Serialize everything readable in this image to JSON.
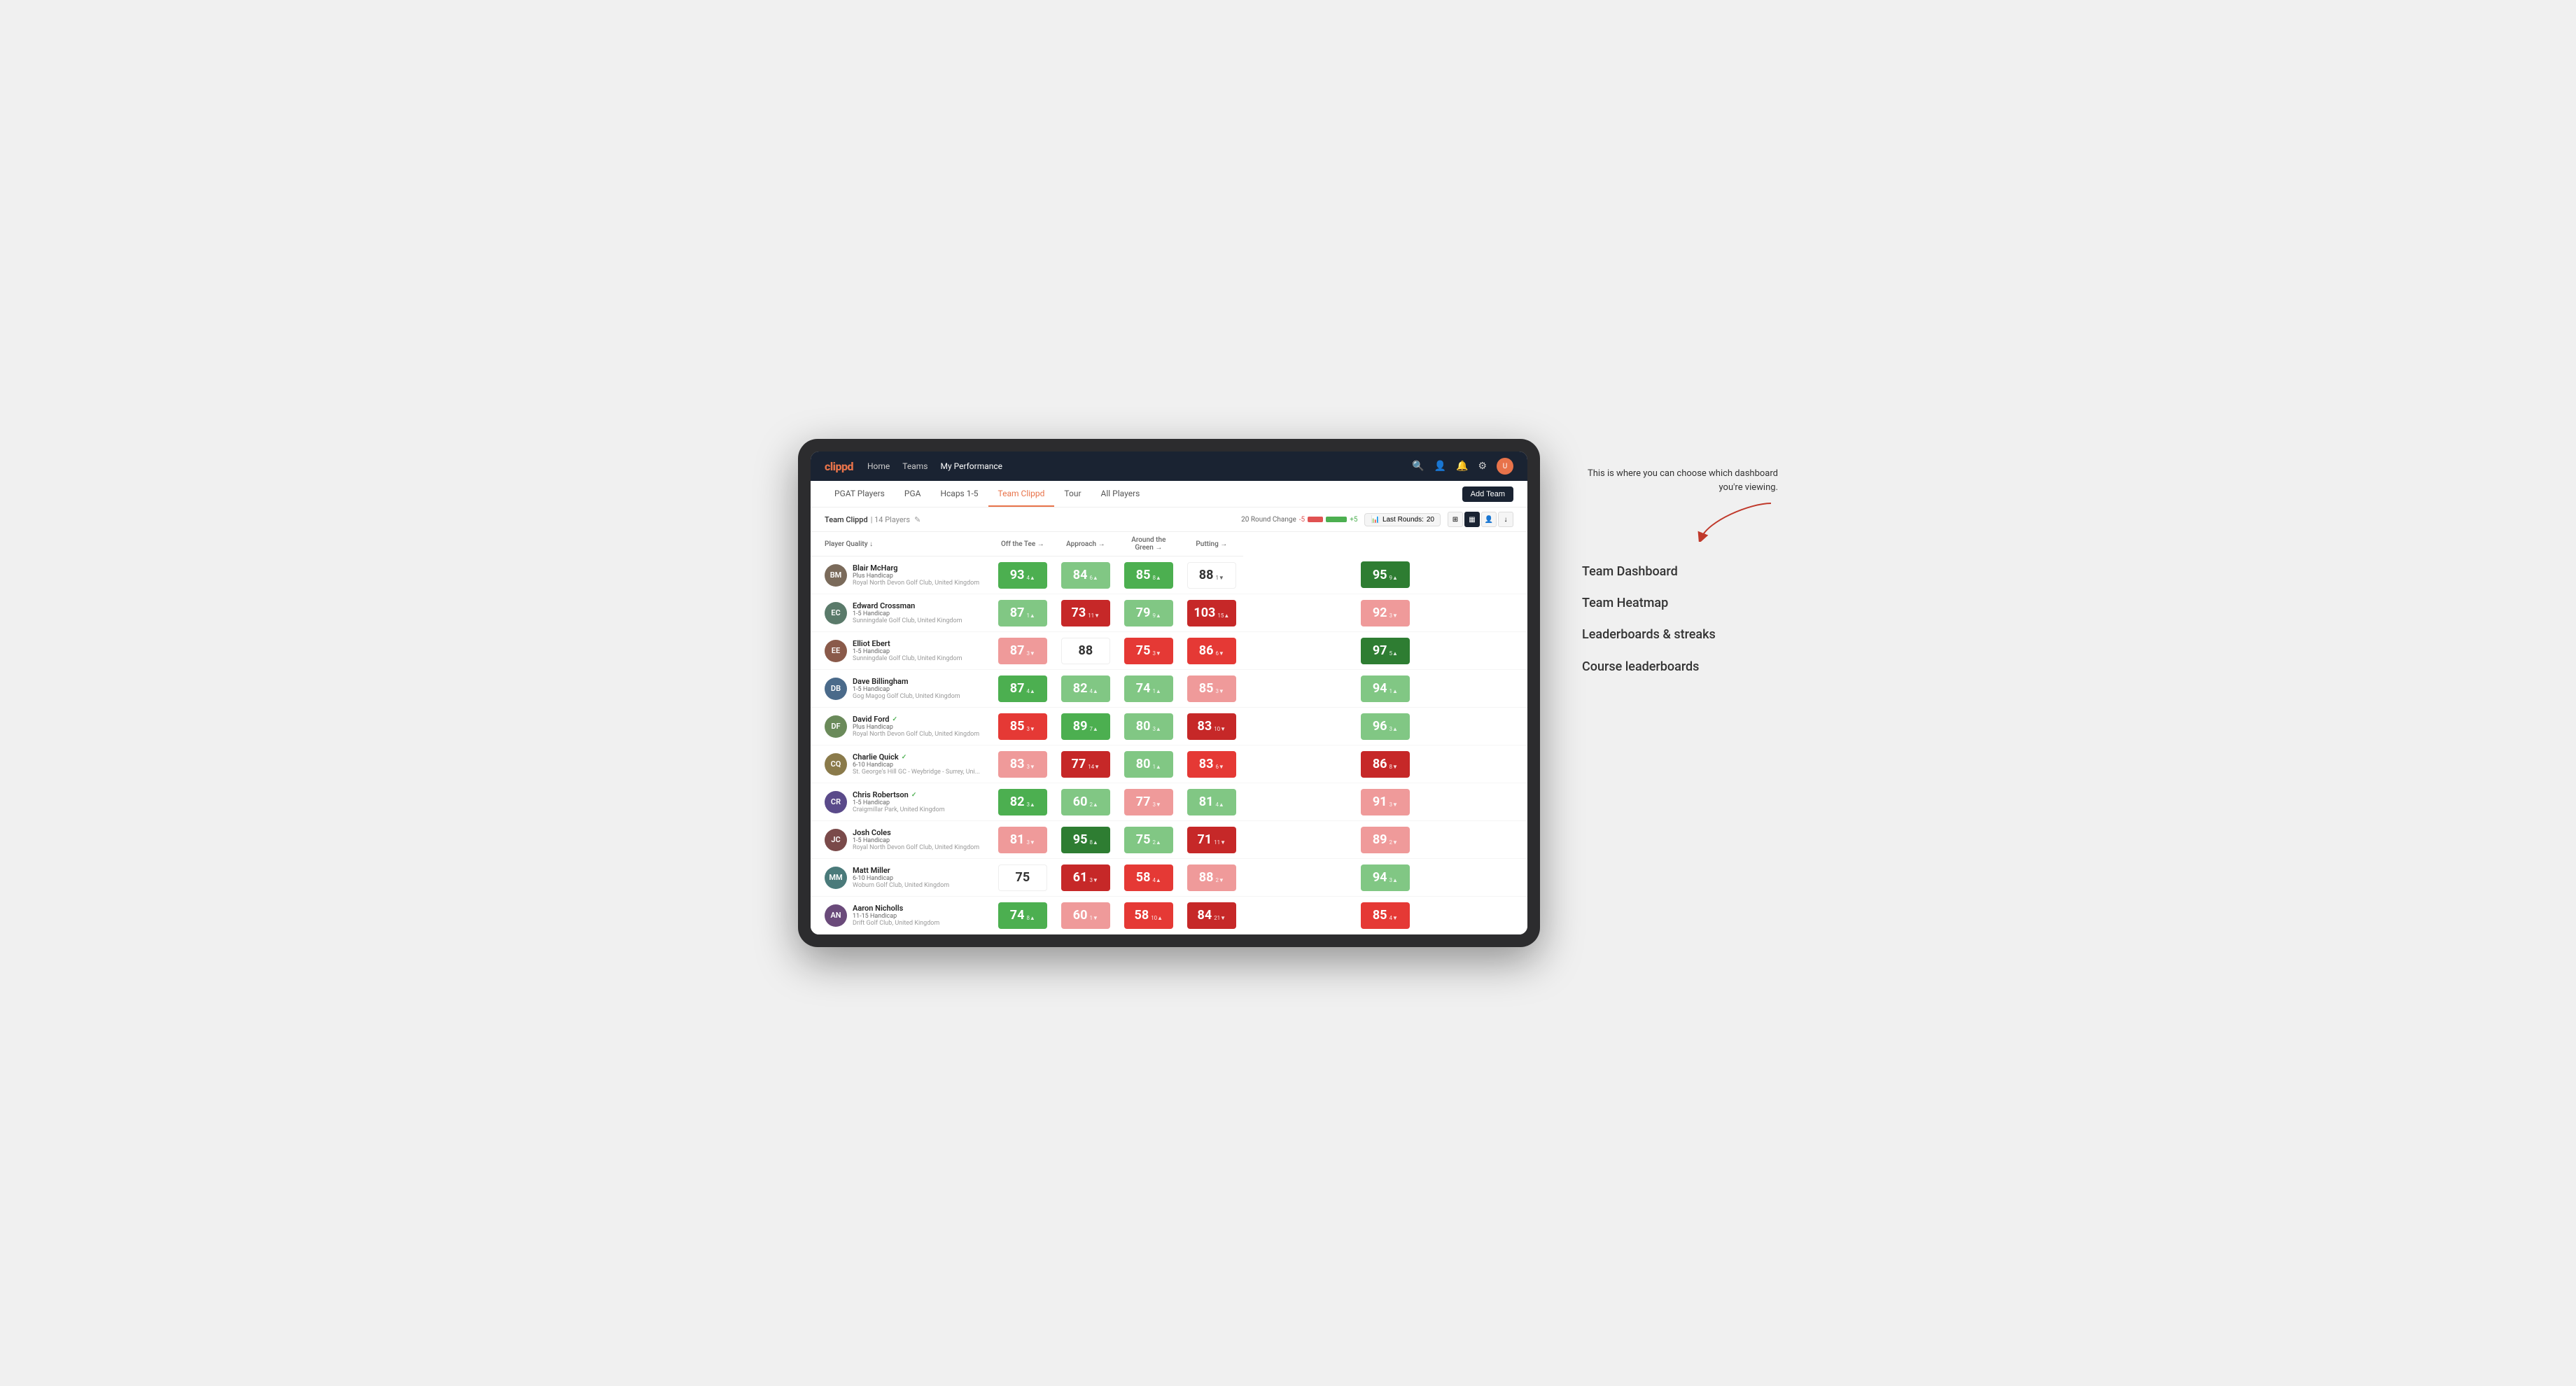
{
  "annotation": {
    "intro_text": "This is where you can choose which dashboard you're viewing.",
    "options": [
      "Team Dashboard",
      "Team Heatmap",
      "Leaderboards & streaks",
      "Course leaderboards"
    ]
  },
  "app": {
    "logo": "clippd",
    "nav_links": [
      {
        "label": "Home",
        "active": false
      },
      {
        "label": "Teams",
        "active": false
      },
      {
        "label": "My Performance",
        "active": true
      }
    ],
    "sub_nav": [
      {
        "label": "PGAT Players",
        "active": false
      },
      {
        "label": "PGA",
        "active": false
      },
      {
        "label": "Hcaps 1-5",
        "active": false
      },
      {
        "label": "Team Clippd",
        "active": true
      },
      {
        "label": "Tour",
        "active": false
      },
      {
        "label": "All Players",
        "active": false
      }
    ],
    "add_team_label": "Add Team"
  },
  "team": {
    "name": "Team Clippd",
    "separator": "|",
    "count": "14 Players",
    "round_change_label": "20 Round Change",
    "range_min": "-5",
    "range_max": "+5",
    "last_rounds_label": "Last Rounds:",
    "last_rounds_value": "20"
  },
  "table": {
    "columns": [
      {
        "label": "Player Quality ↓",
        "group": "player"
      },
      {
        "label": "Off the Tee →",
        "group": "score"
      },
      {
        "label": "Approach →",
        "group": "score"
      },
      {
        "label": "Around the Green →",
        "group": "score"
      },
      {
        "label": "Putting →",
        "group": "score"
      }
    ],
    "players": [
      {
        "name": "Blair McHarg",
        "handicap": "Plus Handicap",
        "club": "Royal North Devon Golf Club, United Kingdom",
        "avatar_color": "#7a6a5a",
        "initials": "BM",
        "scores": [
          {
            "value": "93",
            "change": "4",
            "dir": "up",
            "color": "green-mid"
          },
          {
            "value": "84",
            "change": "6",
            "dir": "up",
            "color": "green-light"
          },
          {
            "value": "85",
            "change": "8",
            "dir": "up",
            "color": "green-mid"
          },
          {
            "value": "88",
            "change": "1",
            "dir": "down",
            "color": "white"
          },
          {
            "value": "95",
            "change": "9",
            "dir": "up",
            "color": "green-dark"
          }
        ]
      },
      {
        "name": "Edward Crossman",
        "handicap": "1-5 Handicap",
        "club": "Sunningdale Golf Club, United Kingdom",
        "avatar_color": "#5a7a6a",
        "initials": "EC",
        "scores": [
          {
            "value": "87",
            "change": "1",
            "dir": "up",
            "color": "green-light"
          },
          {
            "value": "73",
            "change": "11",
            "dir": "down",
            "color": "red-dark"
          },
          {
            "value": "79",
            "change": "9",
            "dir": "up",
            "color": "green-light"
          },
          {
            "value": "103",
            "change": "15",
            "dir": "up",
            "color": "red-dark"
          },
          {
            "value": "92",
            "change": "3",
            "dir": "down",
            "color": "red-light"
          }
        ]
      },
      {
        "name": "Elliot Ebert",
        "handicap": "1-5 Handicap",
        "club": "Sunningdale Golf Club, United Kingdom",
        "avatar_color": "#8a5a4a",
        "initials": "EE",
        "scores": [
          {
            "value": "87",
            "change": "3",
            "dir": "down",
            "color": "red-light"
          },
          {
            "value": "88",
            "change": "",
            "dir": "none",
            "color": "white"
          },
          {
            "value": "75",
            "change": "3",
            "dir": "down",
            "color": "red-mid"
          },
          {
            "value": "86",
            "change": "6",
            "dir": "down",
            "color": "red-mid"
          },
          {
            "value": "97",
            "change": "5",
            "dir": "up",
            "color": "green-dark"
          }
        ]
      },
      {
        "name": "Dave Billingham",
        "handicap": "1-5 Handicap",
        "club": "Gog Magog Golf Club, United Kingdom",
        "avatar_color": "#4a6a8a",
        "initials": "DB",
        "scores": [
          {
            "value": "87",
            "change": "4",
            "dir": "up",
            "color": "green-mid"
          },
          {
            "value": "82",
            "change": "4",
            "dir": "up",
            "color": "green-light"
          },
          {
            "value": "74",
            "change": "1",
            "dir": "up",
            "color": "green-light"
          },
          {
            "value": "85",
            "change": "3",
            "dir": "down",
            "color": "red-light"
          },
          {
            "value": "94",
            "change": "1",
            "dir": "up",
            "color": "green-light"
          }
        ]
      },
      {
        "name": "David Ford",
        "handicap": "Plus Handicap",
        "club": "Royal North Devon Golf Club, United Kingdom",
        "avatar_color": "#6a8a5a",
        "initials": "DF",
        "verified": true,
        "scores": [
          {
            "value": "85",
            "change": "3",
            "dir": "down",
            "color": "red-mid"
          },
          {
            "value": "89",
            "change": "7",
            "dir": "up",
            "color": "green-mid"
          },
          {
            "value": "80",
            "change": "3",
            "dir": "up",
            "color": "green-light"
          },
          {
            "value": "83",
            "change": "10",
            "dir": "down",
            "color": "red-dark"
          },
          {
            "value": "96",
            "change": "3",
            "dir": "up",
            "color": "green-light"
          }
        ]
      },
      {
        "name": "Charlie Quick",
        "handicap": "6-10 Handicap",
        "club": "St. George's Hill GC - Weybridge - Surrey, Uni...",
        "avatar_color": "#8a7a4a",
        "initials": "CQ",
        "verified": true,
        "scores": [
          {
            "value": "83",
            "change": "3",
            "dir": "down",
            "color": "red-light"
          },
          {
            "value": "77",
            "change": "14",
            "dir": "down",
            "color": "red-dark"
          },
          {
            "value": "80",
            "change": "1",
            "dir": "up",
            "color": "green-light"
          },
          {
            "value": "83",
            "change": "6",
            "dir": "down",
            "color": "red-mid"
          },
          {
            "value": "86",
            "change": "8",
            "dir": "down",
            "color": "red-dark"
          }
        ]
      },
      {
        "name": "Chris Robertson",
        "handicap": "1-5 Handicap",
        "club": "Craigmillar Park, United Kingdom",
        "avatar_color": "#5a4a8a",
        "initials": "CR",
        "verified": true,
        "scores": [
          {
            "value": "82",
            "change": "3",
            "dir": "up",
            "color": "green-mid"
          },
          {
            "value": "60",
            "change": "2",
            "dir": "up",
            "color": "green-light"
          },
          {
            "value": "77",
            "change": "3",
            "dir": "down",
            "color": "red-light"
          },
          {
            "value": "81",
            "change": "4",
            "dir": "up",
            "color": "green-light"
          },
          {
            "value": "91",
            "change": "3",
            "dir": "down",
            "color": "red-light"
          }
        ]
      },
      {
        "name": "Josh Coles",
        "handicap": "1-5 Handicap",
        "club": "Royal North Devon Golf Club, United Kingdom",
        "avatar_color": "#7a4a4a",
        "initials": "JC",
        "scores": [
          {
            "value": "81",
            "change": "3",
            "dir": "down",
            "color": "red-light"
          },
          {
            "value": "95",
            "change": "8",
            "dir": "up",
            "color": "green-dark"
          },
          {
            "value": "75",
            "change": "2",
            "dir": "up",
            "color": "green-light"
          },
          {
            "value": "71",
            "change": "11",
            "dir": "down",
            "color": "red-dark"
          },
          {
            "value": "89",
            "change": "2",
            "dir": "down",
            "color": "red-light"
          }
        ]
      },
      {
        "name": "Matt Miller",
        "handicap": "6-10 Handicap",
        "club": "Woburn Golf Club, United Kingdom",
        "avatar_color": "#4a7a7a",
        "initials": "MM",
        "scores": [
          {
            "value": "75",
            "change": "",
            "dir": "none",
            "color": "white"
          },
          {
            "value": "61",
            "change": "3",
            "dir": "down",
            "color": "red-dark"
          },
          {
            "value": "58",
            "change": "4",
            "dir": "up",
            "color": "red-mid"
          },
          {
            "value": "88",
            "change": "2",
            "dir": "down",
            "color": "red-light"
          },
          {
            "value": "94",
            "change": "3",
            "dir": "up",
            "color": "green-light"
          }
        ]
      },
      {
        "name": "Aaron Nicholls",
        "handicap": "11-15 Handicap",
        "club": "Drift Golf Club, United Kingdom",
        "avatar_color": "#6a4a7a",
        "initials": "AN",
        "scores": [
          {
            "value": "74",
            "change": "8",
            "dir": "up",
            "color": "green-mid"
          },
          {
            "value": "60",
            "change": "1",
            "dir": "down",
            "color": "red-light"
          },
          {
            "value": "58",
            "change": "10",
            "dir": "up",
            "color": "red-mid"
          },
          {
            "value": "84",
            "change": "21",
            "dir": "down",
            "color": "red-dark"
          },
          {
            "value": "85",
            "change": "4",
            "dir": "down",
            "color": "red-mid"
          }
        ]
      }
    ]
  }
}
